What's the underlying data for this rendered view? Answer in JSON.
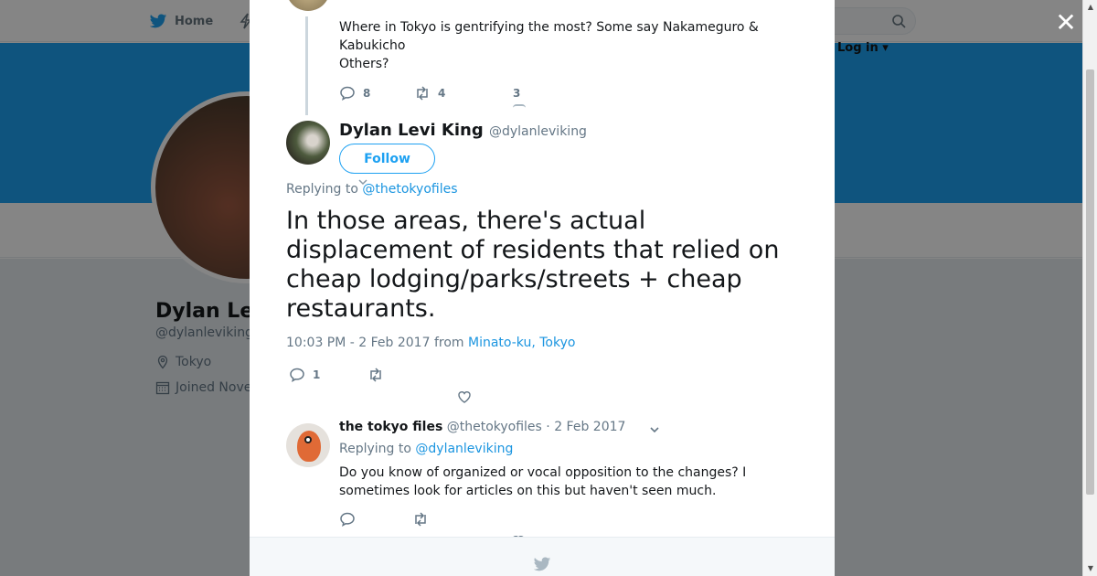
{
  "background_page": {
    "nav": {
      "home_label": "Home",
      "login_label": "Log in ▾"
    },
    "profile": {
      "name": "Dylan Le",
      "handle": "@dylanleviking",
      "location": "Tokyo",
      "joined": "Joined Nove"
    }
  },
  "modal": {
    "close_icon": "close-x",
    "previous_tweet": {
      "text_lines": [
        "Where in Tokyo is gentrifying the most? Some say Nakameguro & Kabukicho",
        "Others?"
      ],
      "reply_count": "8",
      "retweet_count": "4",
      "like_count": "3"
    },
    "main_tweet": {
      "author_name": "Dylan Levi King",
      "author_handle": "@dylanleviking",
      "follow_label": "Follow",
      "replying_prefix": "Replying to",
      "replying_to": "@thetokyofiles",
      "text": "In those areas, there's actual displacement of residents that relied on cheap lodging/parks/streets + cheap restaurants.",
      "timestamp": "10:03 PM - 2 Feb 2017",
      "from_label": "from",
      "location": "Minato-ku, Tokyo",
      "reply_count": "1"
    },
    "reply_tweet": {
      "author_name": "the tokyo files",
      "author_handle": "@thetokyofiles",
      "date": "· 2 Feb 2017",
      "replying_prefix": "Replying to",
      "replying_to": "@dylanleviking",
      "text": "Do you know of organized or vocal opposition to the changes? I sometimes look for articles on this but haven't seen much."
    }
  },
  "colors": {
    "accent": "#1da1f2",
    "link": "#1b95e0",
    "muted_text": "#657786",
    "overlay": "rgba(0,0,0,0.48)"
  }
}
